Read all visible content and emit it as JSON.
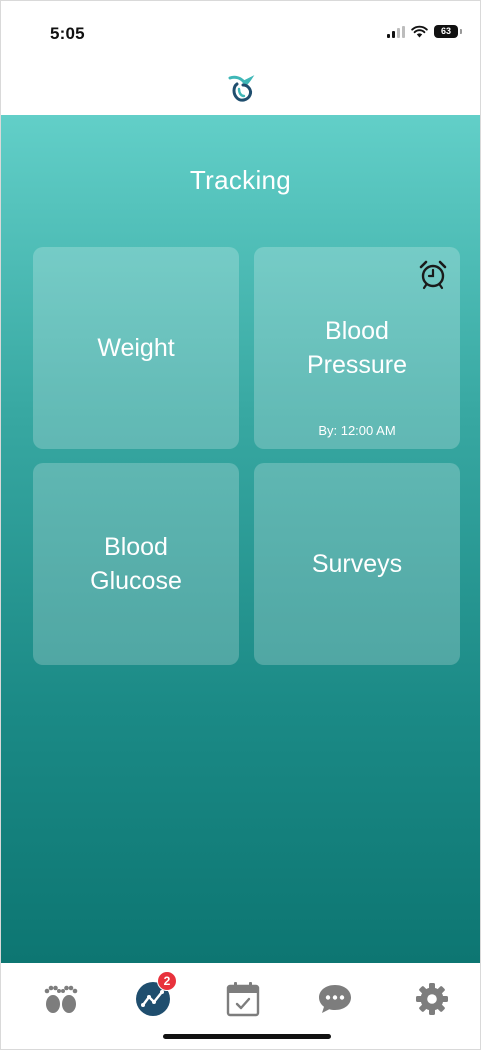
{
  "status_bar": {
    "time": "5:05",
    "battery": "63"
  },
  "header": {
    "logo_icon": "hummingbird-logo-icon"
  },
  "main": {
    "title": "Tracking",
    "tiles": [
      {
        "label": "Weight"
      },
      {
        "label": "Blood Pressure",
        "due": "By: 12:00 AM",
        "icon": "alarm-clock-icon"
      },
      {
        "label": "Blood Glucose"
      },
      {
        "label": "Surveys"
      }
    ]
  },
  "tab_bar": {
    "items": [
      {
        "icon": "footprints-icon"
      },
      {
        "icon": "tracking-graph-icon",
        "badge": "2"
      },
      {
        "icon": "calendar-check-icon"
      },
      {
        "icon": "chat-bubble-icon"
      },
      {
        "icon": "gear-icon"
      }
    ]
  },
  "colors": {
    "gradient_top": "#62cfc8",
    "gradient_bottom": "#0d7672",
    "accent_dark": "#1f4e6e",
    "badge": "#e8323c",
    "tab_icon_gray": "#7d7d7d"
  }
}
